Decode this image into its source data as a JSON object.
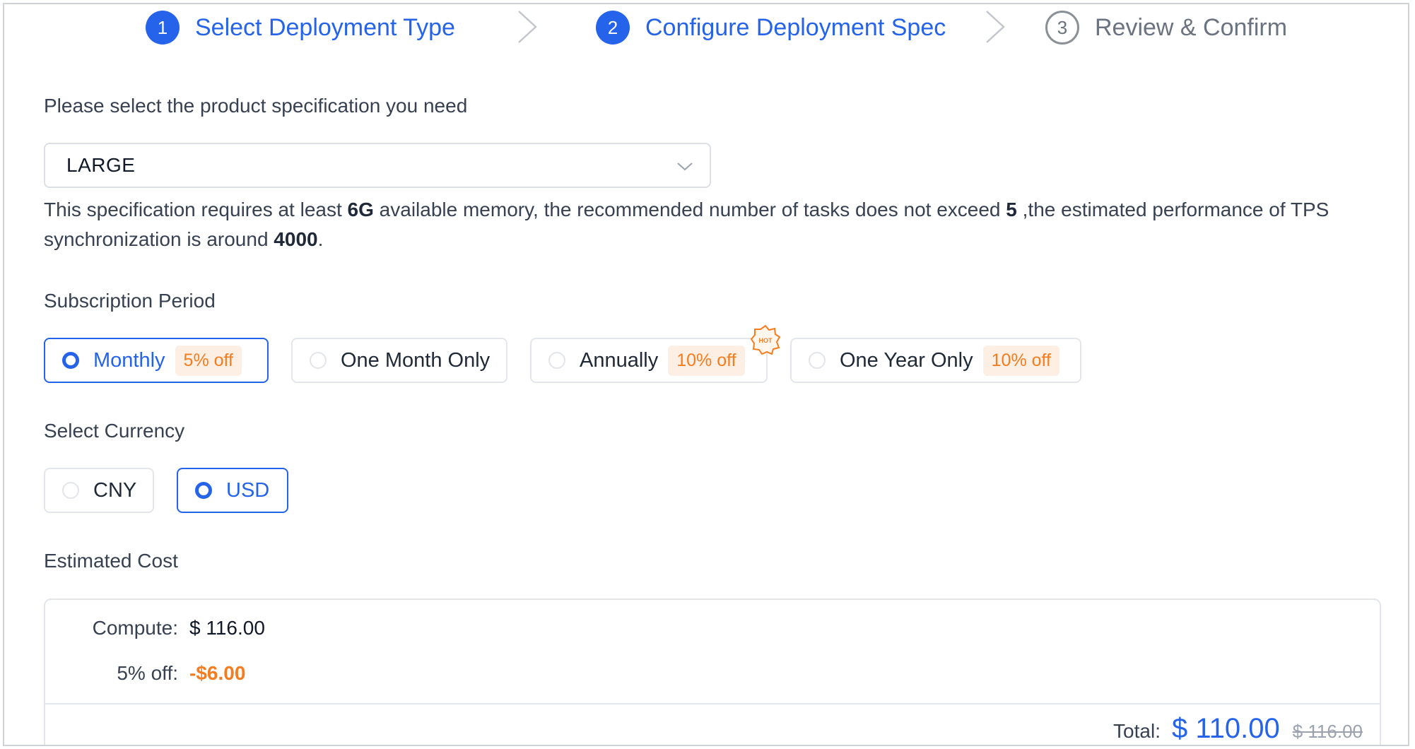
{
  "steps": [
    {
      "num": "1",
      "label": "Select Deployment Type",
      "state": "done"
    },
    {
      "num": "2",
      "label": "Configure Deployment Spec",
      "state": "active"
    },
    {
      "num": "3",
      "label": "Review & Confirm",
      "state": "pending"
    }
  ],
  "spec": {
    "label": "Please select the product specification you need",
    "selected": "LARGE",
    "desc": {
      "p1": "This specification requires at least ",
      "memory": "6G",
      "p2": " available memory, the recommended number of tasks does not exceed ",
      "tasks": "5",
      "p3": " ,the estimated performance of TPS synchronization is around ",
      "tps": "4000",
      "p4": "."
    }
  },
  "subscription": {
    "label": "Subscription Period",
    "options": [
      {
        "label": "Monthly",
        "badge": "5% off",
        "selected": true
      },
      {
        "label": "One Month Only",
        "badge": "",
        "selected": false
      },
      {
        "label": "Annually",
        "badge": "10% off",
        "selected": false,
        "hot": "HOT"
      },
      {
        "label": "One Year Only",
        "badge": "10% off",
        "selected": false
      }
    ]
  },
  "currency": {
    "label": "Select Currency",
    "options": [
      {
        "label": "CNY",
        "selected": false
      },
      {
        "label": "USD",
        "selected": true
      }
    ]
  },
  "cost": {
    "label": "Estimated Cost",
    "compute_label": "Compute:",
    "compute_value": "$ 116.00",
    "discount_label": "5% off:",
    "discount_value": "-$6.00",
    "total_label": "Total:",
    "total_value": "$ 110.00",
    "total_original": "$ 116.00"
  },
  "colors": {
    "primary": "#2563eb",
    "discount": "#f57c1f",
    "badge_bg": "#fdefe3",
    "border": "#e3e6ea"
  }
}
